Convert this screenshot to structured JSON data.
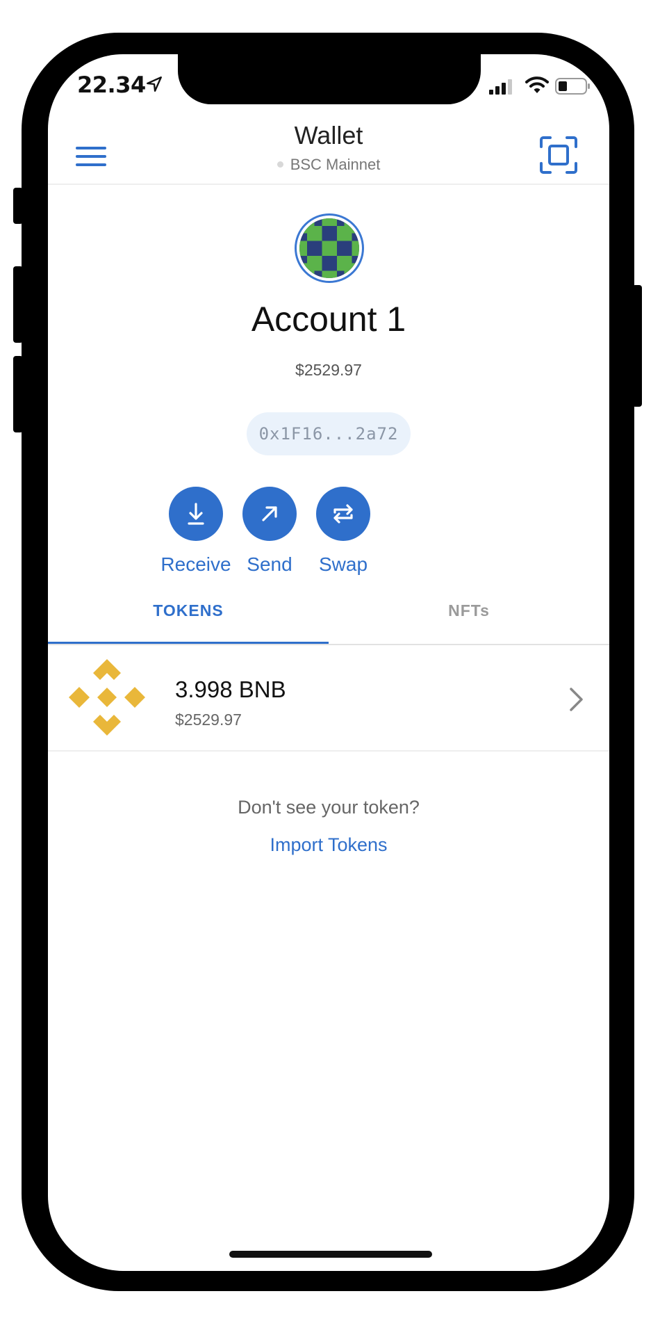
{
  "status_bar": {
    "time": "22.34",
    "icons": [
      "location-arrow-icon",
      "signal-icon",
      "wifi-icon",
      "battery-icon"
    ]
  },
  "header": {
    "title": "Wallet",
    "network": "BSC Mainnet",
    "menu_icon": "hamburger-menu-icon",
    "scan_icon": "qr-scan-icon"
  },
  "account": {
    "name": "Account 1",
    "balance": "$2529.97",
    "address": "0x1F16...2a72"
  },
  "actions": [
    {
      "label": "Receive",
      "icon": "download-arrow-icon"
    },
    {
      "label": "Send",
      "icon": "arrow-up-right-icon"
    },
    {
      "label": "Swap",
      "icon": "swap-arrows-icon"
    }
  ],
  "tabs": [
    {
      "label": "TOKENS",
      "active": true
    },
    {
      "label": "NFTs",
      "active": false
    }
  ],
  "tokens": [
    {
      "amount": "3.998 BNB",
      "value": "$2529.97",
      "icon": "bnb-logo-icon"
    }
  ],
  "empty_prompt": {
    "question": "Don't see your token?",
    "link": "Import Tokens"
  },
  "colors": {
    "accent": "#2f6fcb",
    "bnb_gold": "#e9b73a",
    "address_bg": "#eaf2fb"
  }
}
